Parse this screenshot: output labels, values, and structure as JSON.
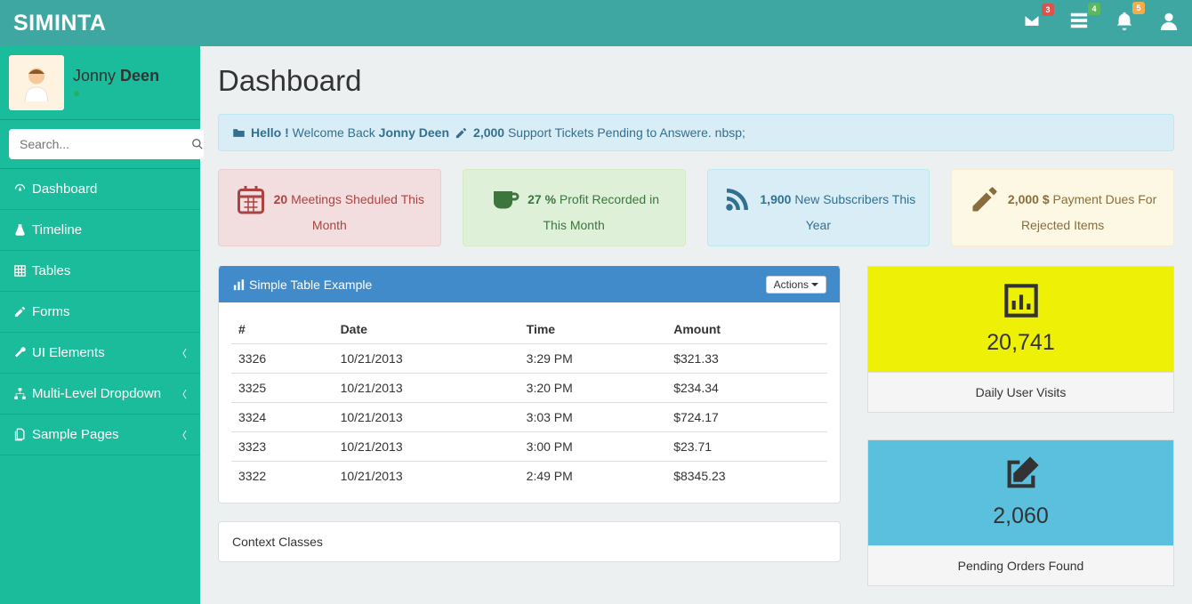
{
  "brand": "SIMINTA",
  "nav_badges": {
    "mail": "3",
    "tasks": "4",
    "alerts": "5"
  },
  "user": {
    "first": "Jonny ",
    "last": "Deen",
    "status": "Online"
  },
  "search": {
    "placeholder": "Search..."
  },
  "menu": {
    "dashboard": "Dashboard",
    "timeline": "Timeline",
    "tables": "Tables",
    "forms": "Forms",
    "ui": "UI Elements",
    "multi": "Multi-Level Dropdown",
    "sample": "Sample Pages"
  },
  "page_title": "Dashboard",
  "alert": {
    "hello": "Hello !",
    "welcome": " Welcome Back ",
    "name": "Jonny Deen",
    "tickets_n": "2,000",
    "tickets_txt": " Support Tickets Pending to Answere. nbsp;"
  },
  "stats": {
    "s1": {
      "n": "20",
      "txt": " Meetings Sheduled This Month"
    },
    "s2": {
      "n": "27 %",
      "txt": " Profit Recorded in This Month"
    },
    "s3": {
      "n": "1,900",
      "txt": " New Subscribers This Year"
    },
    "s4": {
      "n": "2,000 $",
      "txt": " Payment Dues For Rejected Items"
    }
  },
  "table_panel": {
    "title": "Simple Table Example",
    "actions": "Actions "
  },
  "table": {
    "cols": {
      "c1": "#",
      "c2": "Date",
      "c3": "Time",
      "c4": "Amount"
    },
    "r1": {
      "id": "3326",
      "date": "10/21/2013",
      "time": "3:29 PM",
      "amt": "$321.33"
    },
    "r2": {
      "id": "3325",
      "date": "10/21/2013",
      "time": "3:20 PM",
      "amt": "$234.34"
    },
    "r3": {
      "id": "3324",
      "date": "10/21/2013",
      "time": "3:03 PM",
      "amt": "$724.17"
    },
    "r4": {
      "id": "3323",
      "date": "10/21/2013",
      "time": "3:00 PM",
      "amt": "$23.71"
    },
    "r5": {
      "id": "3322",
      "date": "10/21/2013",
      "time": "2:49 PM",
      "amt": "$8345.23"
    }
  },
  "context_panel": "Context Classes",
  "sq1": {
    "value": "20,741",
    "label": "Daily User Visits"
  },
  "sq2": {
    "value": "2,060",
    "label": "Pending Orders Found"
  }
}
